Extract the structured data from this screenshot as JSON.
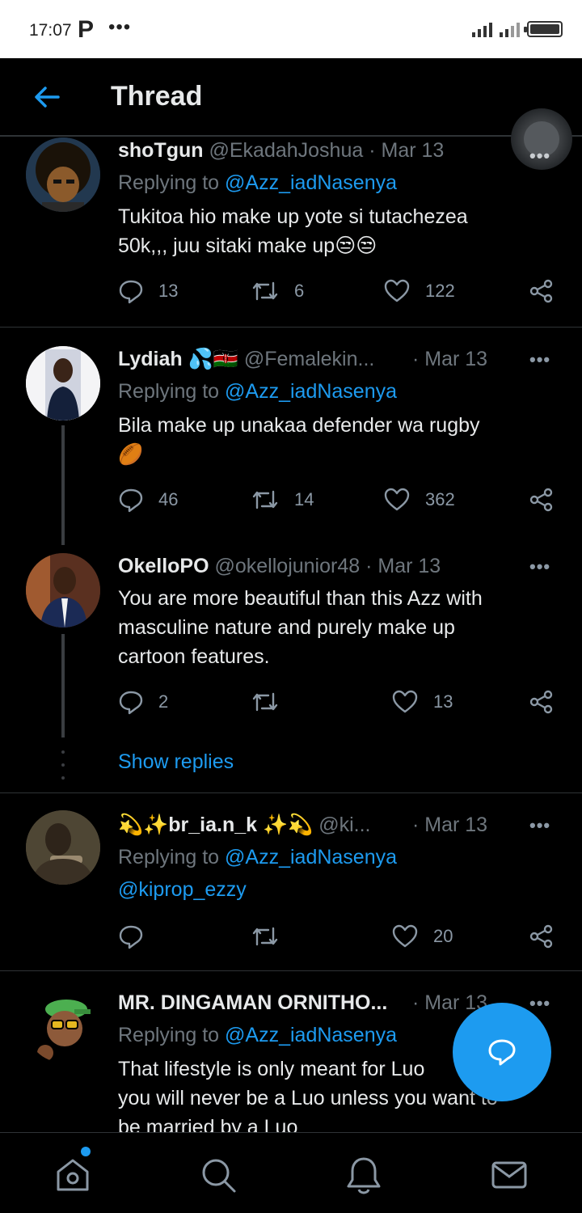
{
  "status_bar": {
    "time": "17:07",
    "app_icon": "P",
    "more": "•••"
  },
  "header": {
    "title": "Thread",
    "back_icon": "arrow-left-icon"
  },
  "colors": {
    "accent": "#1d9bf0",
    "background": "#000000",
    "muted_text": "#6e767d",
    "divider": "#2f3336"
  },
  "tweets": [
    {
      "display_name": "shoTgun",
      "handle": "@EkadahJoshua",
      "date": "· Mar 13",
      "reply_prefix": "Replying to ",
      "reply_to": "@Azz_iadNasenya",
      "text_line1": "Tukitoa hio make up yote si tutachezea",
      "text_line2": "50k,,, juu sitaki make up",
      "emoji": "😒😒",
      "replies": "13",
      "retweets": "6",
      "likes": "122"
    },
    {
      "display_name": "Lydiah",
      "name_emoji": "💦🇰🇪",
      "handle": "@Femalekin...",
      "date": "· Mar 13",
      "reply_prefix": "Replying to ",
      "reply_to": "@Azz_iadNasenya",
      "text_line1": "Bila make up unakaa defender  wa rugby",
      "emoji": "🏉",
      "replies": "46",
      "retweets": "14",
      "likes": "362"
    },
    {
      "display_name": "OkelloPO",
      "handle": "@okellojunior48",
      "date": "· Mar 13",
      "text_line1": "You are more beautiful than this Azz with",
      "text_line2": "masculine nature and purely make up",
      "text_line3": "cartoon features.",
      "replies": "2",
      "retweets": "",
      "likes": "13"
    },
    {
      "display_name": "💫✨br_ia.n_k ✨💫",
      "handle": "@ki...",
      "date": "· Mar 13",
      "reply_prefix": "Replying to ",
      "reply_to": "@Azz_iadNasenya",
      "text_line1": "@kiprop_ezzy",
      "replies": "",
      "retweets": "",
      "likes": "20"
    },
    {
      "display_name": "MR. DINGAMAN ORNITHO...",
      "date": "· Mar 13",
      "reply_prefix": "Replying to ",
      "reply_to": "@Azz_iadNasenya",
      "text_line1": "That lifestyle is only meant for Luo",
      "text_line2": "you will never be a Luo unless you want to",
      "text_line3": "be married by a Luo"
    }
  ],
  "show_replies": "Show replies",
  "more_label": "•••"
}
